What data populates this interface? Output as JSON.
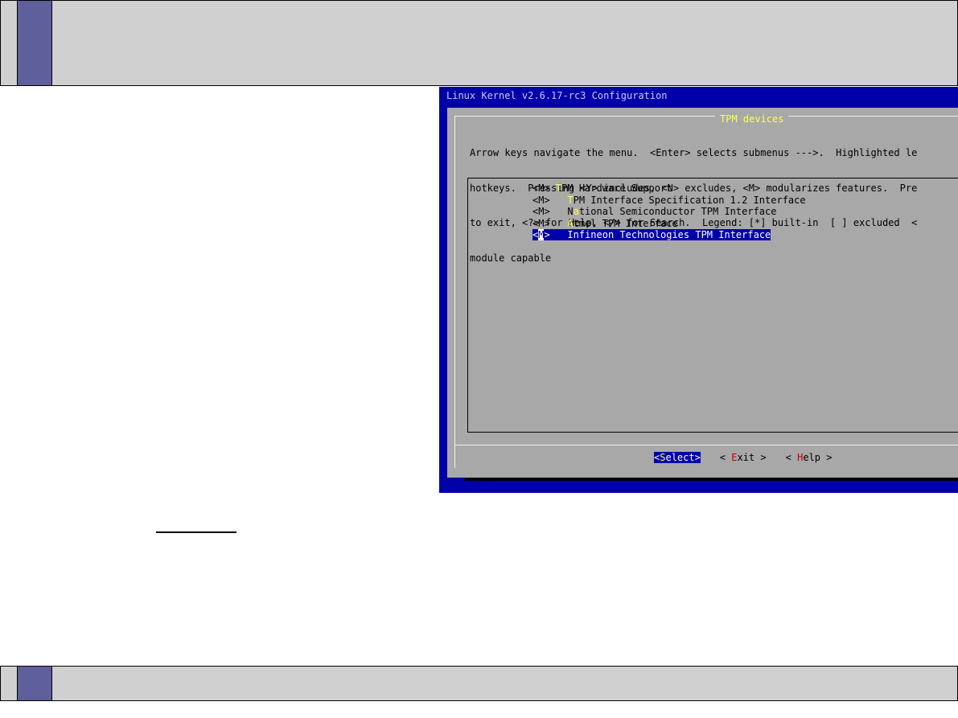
{
  "terminal": {
    "title": "Linux Kernel v2.6.17-rc3 Configuration",
    "dialog_title": "TPM devices",
    "help_lines": [
      "Arrow keys navigate the menu.  <Enter> selects submenus --->.  Highlighted le",
      "hotkeys.  Pressing <Y> includes, <N> excludes, <M> modularizes features.  Pre",
      "to exit, <?> for Help, </> for Search.  Legend: [*] built-in  [ ] excluded  <",
      "module capable"
    ],
    "menu_items": [
      {
        "tag": "<M>",
        "pre": " ",
        "hot": "T",
        "rest": "PM Hardware Support",
        "selected": false
      },
      {
        "tag": "<M>",
        "pre": "   ",
        "hot": "T",
        "rest": "PM Interface Specification 1.2 Interface",
        "selected": false
      },
      {
        "tag": "<M>",
        "pre": "   N",
        "hot": "a",
        "rest": "tional Semiconductor TPM Interface",
        "selected": false
      },
      {
        "tag": "<M>",
        "pre": "   ",
        "hot": "A",
        "rest": "tmel TPM Interface",
        "selected": false
      },
      {
        "tag": "<M>",
        "pre": "   ",
        "hot": "I",
        "rest": "nfineon Technologies TPM Interface",
        "selected": true
      }
    ],
    "buttons": [
      {
        "name": "select",
        "open": "<",
        "hk": "S",
        "rest": "elect",
        "close": ">",
        "selected": true
      },
      {
        "name": "exit",
        "open": "< ",
        "hk": "E",
        "rest": "xit",
        "close": " >",
        "selected": false
      },
      {
        "name": "help",
        "open": "< ",
        "hk": "H",
        "rest": "elp",
        "close": " >",
        "selected": false
      }
    ]
  },
  "colors": {
    "band_grey": "#d0d0d0",
    "band_square": "#5f5f9c",
    "terminal_blue": "#0000a8",
    "dialog_grey": "#a8a8a8",
    "hotkey_yellow": "#ffff55",
    "button_hotkey_red": "#c00000"
  }
}
